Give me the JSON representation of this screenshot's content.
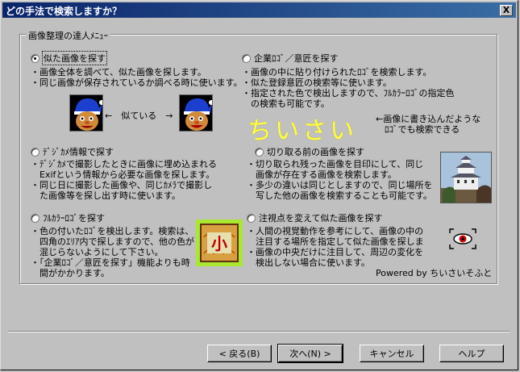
{
  "window": {
    "title": "どの手法で検索しますか？",
    "close_label": "X"
  },
  "group": {
    "label": "画像整理の達人ﾒﾆｭｰ"
  },
  "options": [
    {
      "label": "似た画像を探す",
      "selected": true,
      "desc": "・画像全体を調べて、似た画像を探します。\n・同じ画像が保存されているか調べる時に使います。"
    },
    {
      "label": "企業ﾛｺﾞ／意匠を探す",
      "selected": false,
      "desc": "・画像の中に貼り付けられたﾛｺﾞを検索します。\n・似た登録意匠の検索等に使います。\n・指定された色で検出しますので、ﾌﾙｶﾗｰﾛｺﾞの指定色\n　の検索も可能です。"
    },
    {
      "label": "ﾃﾞｼﾞｶﾒ情報で探す",
      "selected": false,
      "desc": "・ﾃﾞｼﾞｶﾒで撮影したときに画像に埋め込まれる\n　Exifという情報から必要な画像を探します。\n・同じ日に撮影した画像や、同じｶﾒﾗで撮影し\n　た画像等を探し出す時に使います。"
    },
    {
      "label": "切り取る前の画像を探す",
      "selected": false,
      "desc": "・切り取られ残った画像を目印にして、同じ\n　画像が存在する画像を検索します。\n・多少の違いは同じとしますので、同じ場所を\n　写した他の画像を検索することも可能です。"
    },
    {
      "label": "ﾌﾙｶﾗｰﾛｺﾞを探す",
      "selected": false,
      "desc": "・色の付いたﾛｺﾞを検出します。検索は、\n　四角のｴﾘｱ内で探しますので、他の色が\n　混じらないようにして下さい。\n・「企業ﾛｺﾞ／意匠を探す」機能よりも時\n　間がかかります。"
    },
    {
      "label": "注視点を変えて似た画像を探す",
      "selected": false,
      "desc": "・人間の視覚動作を参考にして、画像の中の\n　注目する場所を指定して似た画像を探しま\n・画像の中央だけに注目して、周辺の変化を\n　検出しない場合に使います。"
    }
  ],
  "similar_text": "←　似ている　→",
  "chiisai_text": "ちいさい",
  "chiisai_note": "←画像に書き込んだような\n　ﾛｺﾞでも検索できる",
  "logo_char": "小",
  "powered_by": "Powered by  ちいさいそふと",
  "buttons": {
    "back": "< 戻る(B)",
    "next": "次へ(N) >",
    "cancel": "キャンセル",
    "help": "ヘルプ"
  }
}
